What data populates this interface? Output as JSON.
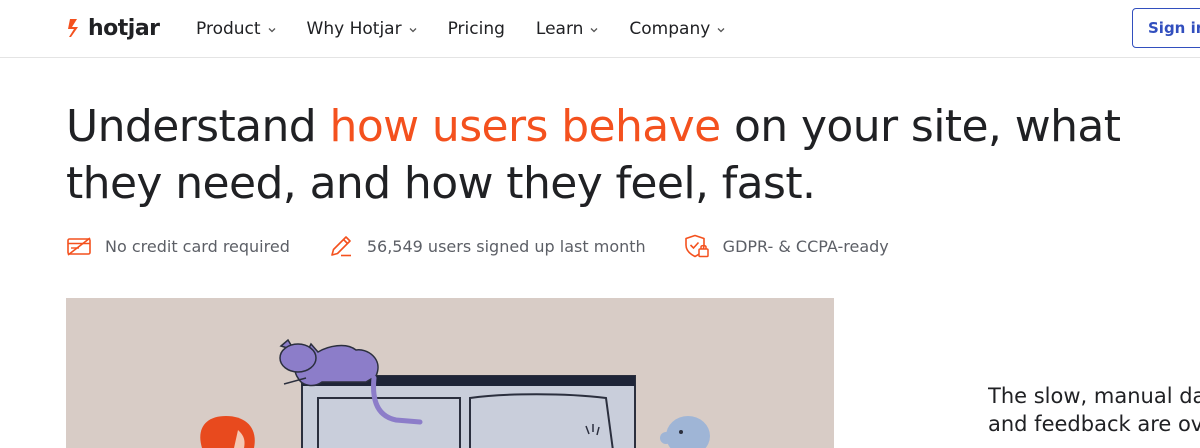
{
  "brand": {
    "name": "hotjar",
    "accent_color": "#f4511e",
    "link_color": "#324fbe"
  },
  "nav": {
    "items": [
      {
        "label": "Product",
        "has_dropdown": true
      },
      {
        "label": "Why Hotjar",
        "has_dropdown": true
      },
      {
        "label": "Pricing",
        "has_dropdown": false
      },
      {
        "label": "Learn",
        "has_dropdown": true
      },
      {
        "label": "Company",
        "has_dropdown": true
      }
    ],
    "signin_label": "Sign in"
  },
  "hero": {
    "headline_before": "Understand ",
    "headline_accent": "how users behave",
    "headline_after": " on your site, what they need, and how they feel, fast.",
    "badges": [
      {
        "icon": "credit-card-off-icon",
        "text": "No credit card required"
      },
      {
        "icon": "pencil-icon",
        "text": "56,549 users signed up last month"
      },
      {
        "icon": "shield-lock-icon",
        "text": "GDPR- & CCPA-ready"
      }
    ]
  },
  "side": {
    "line1": "The slow, manual da",
    "line2": "and feedback are ov"
  }
}
